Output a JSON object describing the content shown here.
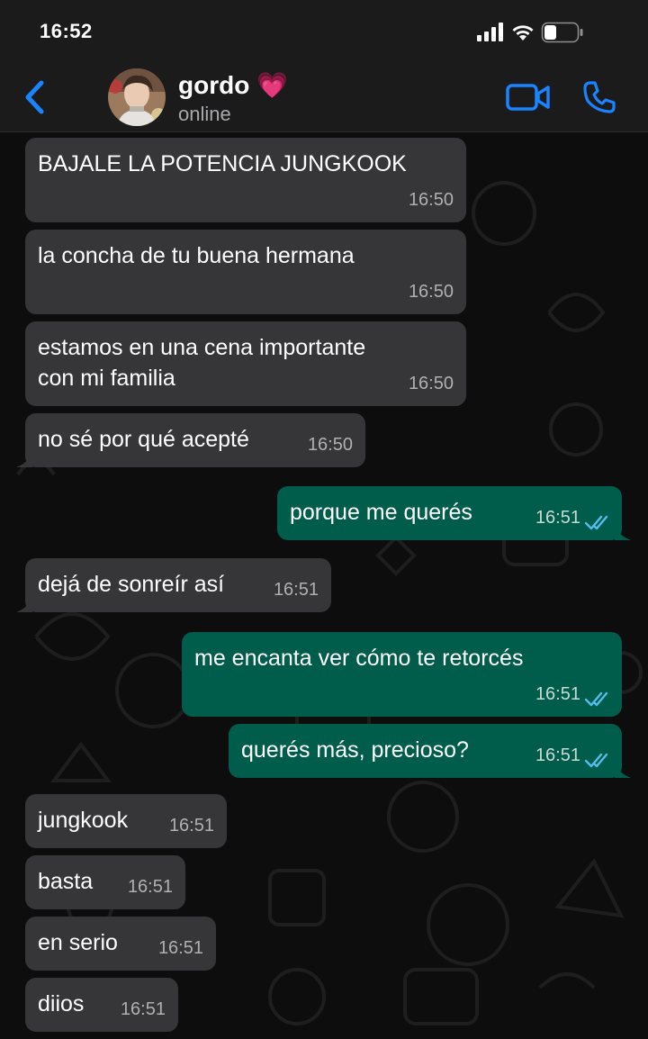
{
  "status_bar": {
    "time": "16:52"
  },
  "header": {
    "contact_name": "gordo",
    "contact_emoji": "💗",
    "contact_status": "online"
  },
  "colors": {
    "accent": "#1a84ff",
    "incoming_bubble": "#363638",
    "outgoing_bubble": "#005c4b",
    "read_ticks": "#53bdeb"
  },
  "messages": [
    {
      "direction": "in",
      "text_lines": [
        "BAJALE LA POTENCIA JUNGKOOK"
      ],
      "time": "16:50"
    },
    {
      "direction": "in",
      "text_lines": [
        "la concha de tu buena hermana"
      ],
      "time": "16:50"
    },
    {
      "direction": "in",
      "text_lines": [
        "estamos en una cena importante",
        "con mi familia"
      ],
      "time": "16:50"
    },
    {
      "direction": "in",
      "text_lines": [
        "no sé por qué acepté"
      ],
      "time": "16:50"
    },
    {
      "direction": "out",
      "text_lines": [
        "porque me querés"
      ],
      "time": "16:51",
      "read": true
    },
    {
      "direction": "in",
      "text_lines": [
        "dejá de sonreír así"
      ],
      "time": "16:51"
    },
    {
      "direction": "out",
      "text_lines": [
        "me encanta ver cómo te retorcés"
      ],
      "time": "16:51",
      "read": true
    },
    {
      "direction": "out",
      "text_lines": [
        "querés más, precioso?"
      ],
      "time": "16:51",
      "read": true
    },
    {
      "direction": "in",
      "text_lines": [
        "jungkook"
      ],
      "time": "16:51"
    },
    {
      "direction": "in",
      "text_lines": [
        "basta"
      ],
      "time": "16:51"
    },
    {
      "direction": "in",
      "text_lines": [
        "en serio"
      ],
      "time": "16:51"
    },
    {
      "direction": "in",
      "text_lines": [
        "diios"
      ],
      "time": "16:51"
    }
  ]
}
